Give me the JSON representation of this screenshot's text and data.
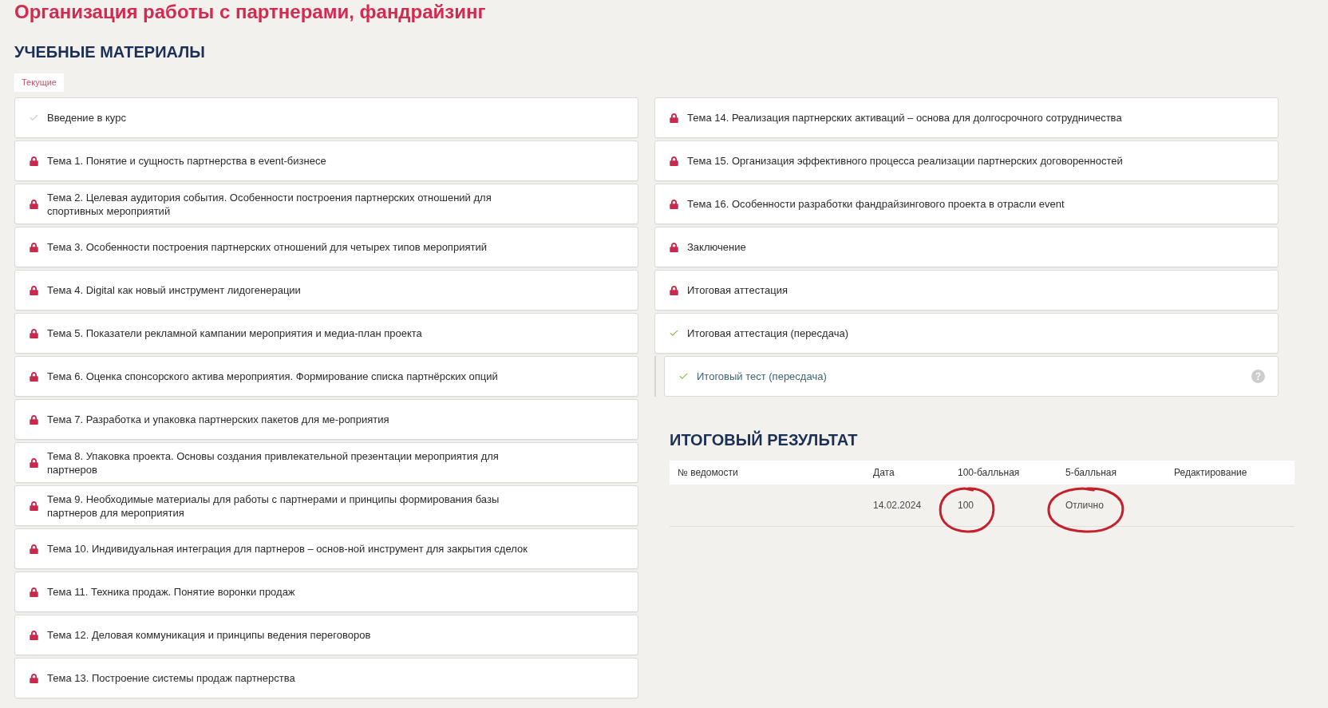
{
  "page_title": "Организация работы с партнерами, фандрайзинг",
  "materials": {
    "heading": "УЧЕБНЫЕ МАТЕРИАЛЫ",
    "tabs": [
      {
        "label": "Текущие",
        "selected": true
      }
    ],
    "left_column": [
      {
        "title": "Введение в курс",
        "kind": "viewed"
      },
      {
        "title": "Тема 1. Понятие и сущность партнерства в event-бизнесе",
        "kind": "locked"
      },
      {
        "title": "Тема 2. Целевая аудитория события. Особенности построения партнерских отношений для спортивных мероприятий",
        "kind": "locked"
      },
      {
        "title": "Тема 3. Особенности построения партнерских отношений для четырех типов мероприятий",
        "kind": "locked"
      },
      {
        "title": "Тема 4. Digital как новый инструмент лидогенерации",
        "kind": "locked"
      },
      {
        "title": "Тема 5. Показатели рекламной кампании мероприятия и медиа-план проекта",
        "kind": "locked"
      },
      {
        "title": "Тема 6. Оценка спонсорского актива мероприятия. Формирование списка партнёрских опций",
        "kind": "locked"
      },
      {
        "title": "Тема 7. Разработка и упаковка партнерских пакетов для ме-роприятия",
        "kind": "locked"
      },
      {
        "title": "Тема 8. Упаковка проекта. Основы создания привлекательной презентации мероприятия для партнеров",
        "kind": "locked"
      },
      {
        "title": "Тема 9. Необходимые материалы для работы с партнерами и принципы формирования базы партнеров для мероприятия",
        "kind": "locked"
      },
      {
        "title": "Тема 10. Индивидуальная интеграция для партнеров – основ-ной инструмент для закрытия сделок",
        "kind": "locked"
      },
      {
        "title": "Тема 11. Техника продаж. Понятие воронки продаж",
        "kind": "locked"
      },
      {
        "title": "Тема 12. Деловая коммуникация и принципы ведения переговоров",
        "kind": "locked"
      },
      {
        "title": "Тема 13. Построение системы продаж партнерства",
        "kind": "locked"
      }
    ],
    "right_column": [
      {
        "title": "Тема 14. Реализация партнерских активаций – основа для долгосрочного сотрудничества",
        "kind": "locked"
      },
      {
        "title": "Тема 15. Организация эффективного процесса реализации партнерских договоренностей",
        "kind": "locked"
      },
      {
        "title": "Тема 16. Особенности разработки фандрайзингового проекта в отрасли event",
        "kind": "locked"
      },
      {
        "title": "Заключение",
        "kind": "locked"
      },
      {
        "title": "Итоговая аттестация",
        "kind": "locked"
      },
      {
        "title": "Итоговая аттестация (пересдача)",
        "kind": "passed",
        "children": [
          {
            "title": "Итоговый тест (пересдача)",
            "kind": "passed"
          }
        ]
      }
    ]
  },
  "final_result": {
    "heading": "ИТОГОВЫЙ РЕЗУЛЬТАТ",
    "columns": [
      "№ ведомости",
      "Дата",
      "100-балльная",
      "5-балльная",
      "Редактирование"
    ],
    "rows": [
      {
        "date": {
          "text": "14.02.2024"
        },
        "score_100": {
          "text": "100",
          "circled": true
        },
        "score_5": {
          "text": "Отлично",
          "circled": true
        }
      }
    ]
  }
}
